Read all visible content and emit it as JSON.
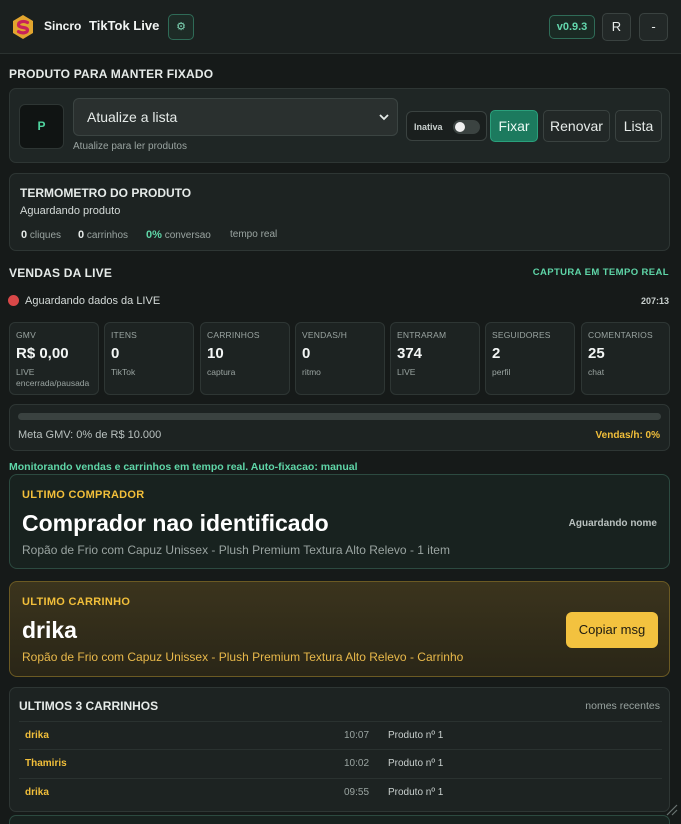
{
  "topbar": {
    "brand": "Sincro",
    "title": "TikTok Live",
    "settings_icon": "gear-icon",
    "version": "v0.9.3",
    "btn_r": "R",
    "btn_min": "-"
  },
  "pin": {
    "section_title": "PRODUTO PARA MANTER FIXADO",
    "avatar_letter": "P",
    "select_value": "Atualize a lista",
    "hint": "Atualize para ler produtos",
    "toggle_label": "Inativa",
    "toggle_on": false,
    "btn_fix": "Fixar",
    "btn_renew": "Renovar",
    "btn_list": "Lista"
  },
  "thermo": {
    "title": "TERMOMETRO DO PRODUTO",
    "status": "Aguardando produto",
    "clicks_value": "0",
    "clicks_label": "cliques",
    "carts_value": "0",
    "carts_label": "carrinhos",
    "conv_value": "0%",
    "conv_label": "conversao",
    "realtime": "tempo real"
  },
  "live": {
    "section_title": "VENDAS DA LIVE",
    "capture_label": "CAPTURA EM TEMPO REAL",
    "status": "Aguardando dados da LIVE",
    "timer": "207:13",
    "metrics": [
      {
        "label": "GMV",
        "value": "R$ 0,00",
        "sub": "LIVE encerrada/pausada"
      },
      {
        "label": "ITENS",
        "value": "0",
        "sub": "TikTok"
      },
      {
        "label": "CARRINHOS",
        "value": "10",
        "sub": "captura"
      },
      {
        "label": "VENDAS/H",
        "value": "0",
        "sub": "ritmo"
      },
      {
        "label": "ENTRARAM",
        "value": "374",
        "sub": "LIVE"
      },
      {
        "label": "SEGUIDORES",
        "value": "2",
        "sub": "perfil"
      },
      {
        "label": "COMENTARIOS",
        "value": "25",
        "sub": "chat"
      }
    ],
    "meta_text": "Meta GMV: 0% de R$ 10.000",
    "meta_progress": 0,
    "sales_rate": "Vendas/h: 0%",
    "monitor_text": "Monitorando vendas e carrinhos em tempo real. Auto-fixacao: manual"
  },
  "buyer": {
    "kicker": "ULTIMO COMPRADOR",
    "name": "Comprador nao identificado",
    "status": "Aguardando nome",
    "desc": "Ropão de Frio com Capuz Unissex - Plush Premium Textura Alto Relevo - 1 item"
  },
  "cart": {
    "kicker": "ULTIMO CARRINHO",
    "name": "drika",
    "desc": "Ropão de Frio com Capuz Unissex - Plush Premium Textura Alto Relevo - Carrinho",
    "copy_btn": "Copiar msg"
  },
  "recent": {
    "title": "ULTIMOS 3 CARRINHOS",
    "subtitle": "nomes recentes",
    "rows": [
      {
        "name": "drika",
        "time": "10:07",
        "product": "Produto nº 1"
      },
      {
        "name": "Thamiris",
        "time": "10:02",
        "product": "Produto nº 1"
      },
      {
        "name": "drika",
        "time": "09:55",
        "product": "Produto nº 1"
      }
    ]
  },
  "colors": {
    "accent_green": "#5fd6a8",
    "accent_yellow": "#f2bf3a",
    "primary_button": "#1c7a5e",
    "live_dot": "#d94848"
  }
}
